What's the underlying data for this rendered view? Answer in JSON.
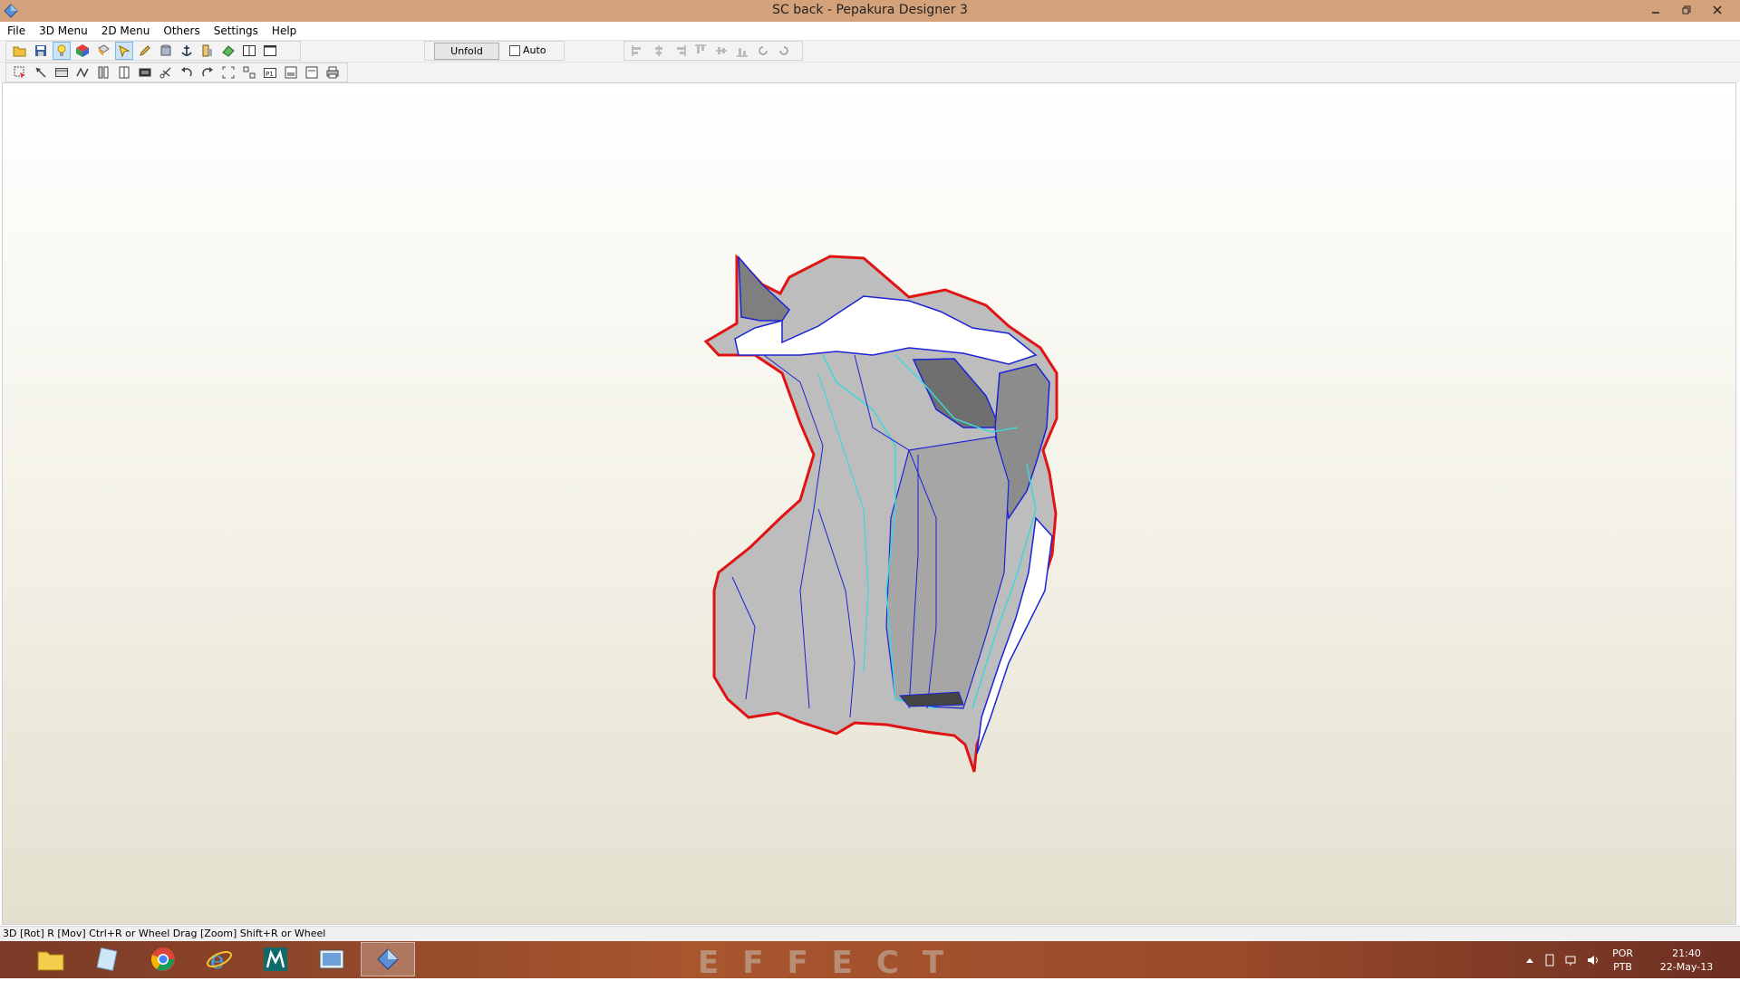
{
  "window": {
    "title": "SC back - Pepakura Designer 3"
  },
  "menu": [
    "File",
    "3D Menu",
    "2D Menu",
    "Others",
    "Settings",
    "Help"
  ],
  "toolbar": {
    "unfold_label": "Unfold",
    "auto_label": "Auto",
    "auto_checked": false
  },
  "viewport": {
    "mode": "3D",
    "model_colors": {
      "face_light": "#c9c9c9",
      "face_dark": "#7f7f7f",
      "edge_blue": "#1a23d6",
      "edge_cyan": "#3fd6dc",
      "cut_red": "#e01414"
    }
  },
  "status": {
    "text": "3D [Rot] R [Mov] Ctrl+R or Wheel Drag [Zoom] Shift+R or Wheel"
  },
  "taskbar": {
    "wallpaper_text": "EFFECT",
    "lang_top": "POR",
    "lang_bottom": "PTB",
    "time": "21:40",
    "date": "22-May-13"
  }
}
